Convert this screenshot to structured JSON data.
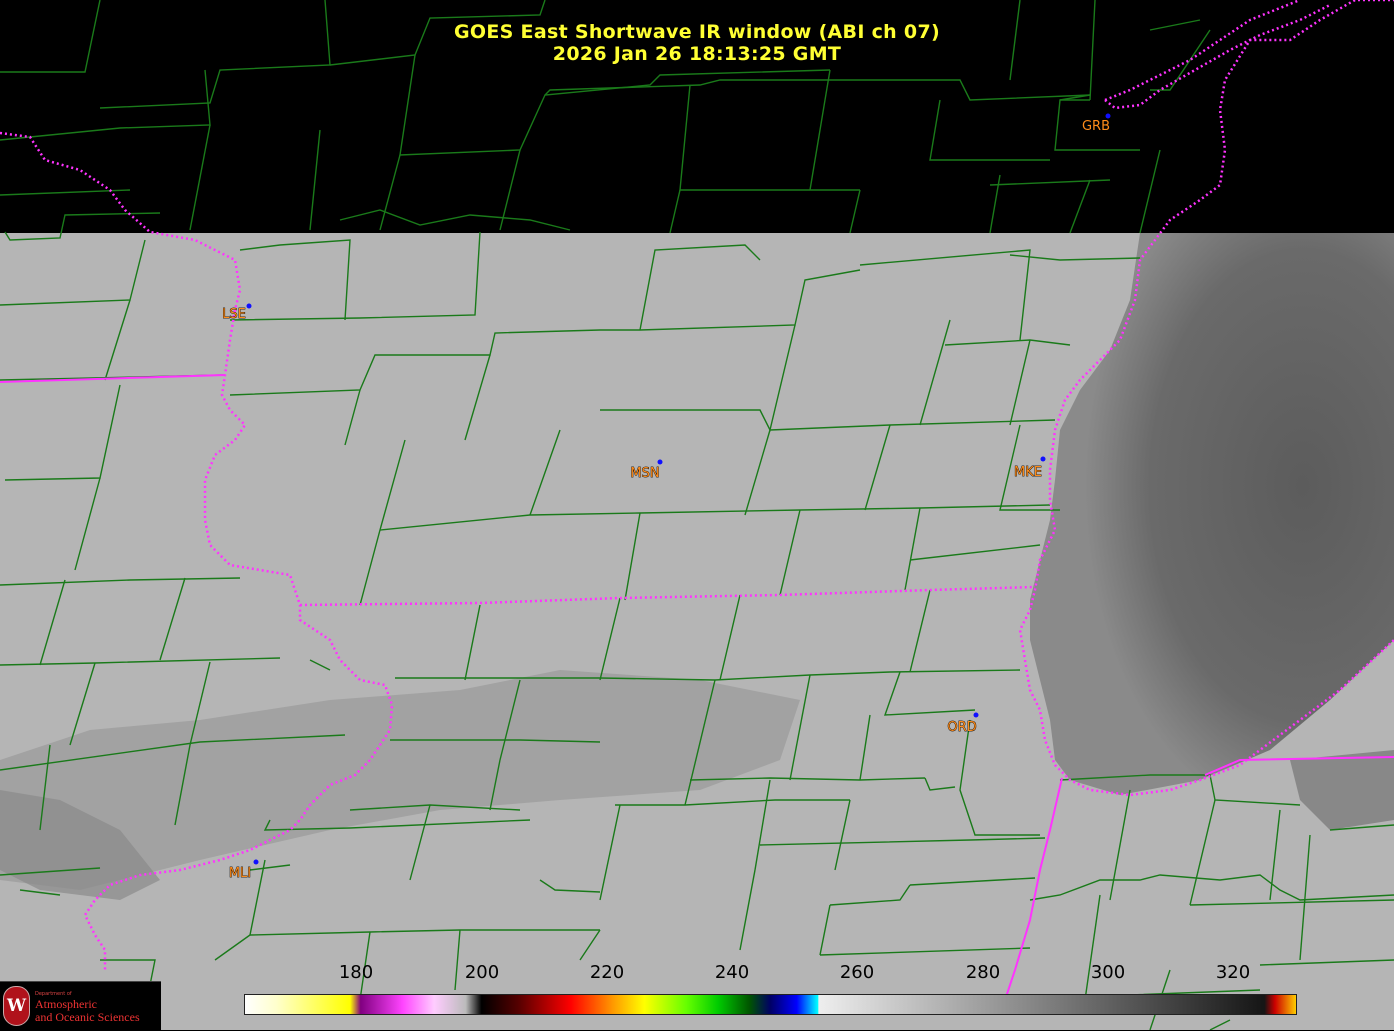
{
  "title": {
    "line1": "GOES East Shortwave IR window (ABI ch 07)",
    "line2": "2026 Jan 26  18:13:25 GMT",
    "color": "#ffff33"
  },
  "stations": [
    {
      "code": "GRB",
      "dot_color": "#1010ff",
      "label_color": "#ff8c1a",
      "outlined": false
    },
    {
      "code": "LSE",
      "dot_color": "#1010ff",
      "label_color": "#ff8c1a",
      "outlined": true
    },
    {
      "code": "MSN",
      "dot_color": "#1010ff",
      "label_color": "#ff8c1a",
      "outlined": true
    },
    {
      "code": "MKE",
      "dot_color": "#1010ff",
      "label_color": "#ff8c1a",
      "outlined": true
    },
    {
      "code": "ORD",
      "dot_color": "#1010ff",
      "label_color": "#ff8c1a",
      "outlined": true
    },
    {
      "code": "MLI",
      "dot_color": "#1010ff",
      "label_color": "#ff8c1a",
      "outlined": true
    }
  ],
  "colorbar": {
    "ticks": [
      "180",
      "200",
      "220",
      "240",
      "260",
      "280",
      "300",
      "320"
    ],
    "range": [
      163,
      330
    ]
  },
  "logo": {
    "department": "Department of",
    "name_line1": "Atmospheric",
    "name_line2": "and Oceanic Sciences",
    "seal_letter": "W"
  },
  "colors": {
    "county_lines": "#1a7a1a",
    "state_borders": "#ff33ff",
    "background_no_data": "#000000",
    "land_gray": "#b6b6b6",
    "lake_gray": "#6e6e6e"
  }
}
